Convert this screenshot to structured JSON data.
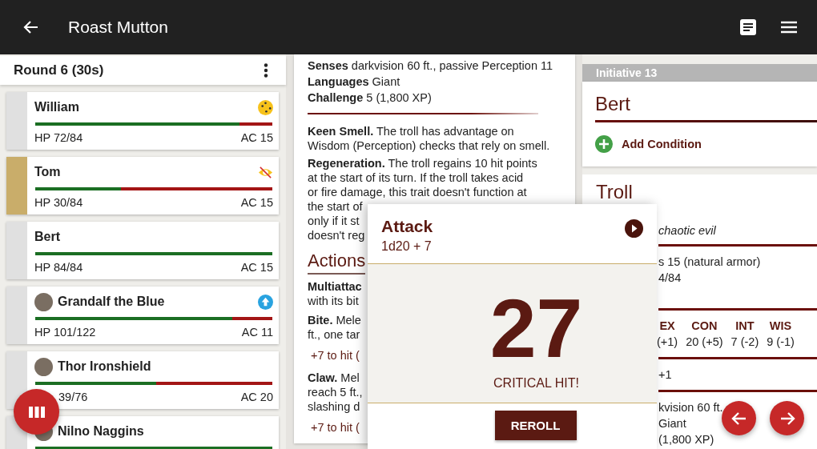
{
  "app_bar": {
    "title": "Roast Mutton"
  },
  "round": {
    "label": "Round 6 (30s)"
  },
  "combatants": [
    {
      "name": "William",
      "kind": "dazed",
      "avatar": false,
      "active": false,
      "level": 0.86,
      "hp": "HP 72/84",
      "ac": "AC 15"
    },
    {
      "name": "Tom",
      "kind": "unseen",
      "avatar": false,
      "active": true,
      "level": 0.36,
      "hp": "HP 30/84",
      "ac": "AC 15"
    },
    {
      "name": "Bert",
      "kind": "plain",
      "avatar": false,
      "active": false,
      "level": 1,
      "hp": "HP 84/84",
      "ac": "AC 15"
    },
    {
      "name": "Grandalf the Blue",
      "kind": "boosted",
      "avatar": true,
      "active": false,
      "level": 0.83,
      "hp": "HP 101/122",
      "ac": "AC 11"
    },
    {
      "name": "Thor Ironshield",
      "kind": "plain",
      "avatar": true,
      "active": false,
      "level": 0.51,
      "hp": "39/76",
      "ac": "AC 20",
      "hp_partly_hidden": true
    },
    {
      "name": "Nilno Naggins",
      "kind": "plain",
      "avatar": true,
      "active": false,
      "level": 1
    }
  ],
  "stat_block": {
    "properties": [
      "**Senses** darkvision 60 ft., passive Perception 11",
      "**Languages** Giant",
      "**Challenge** 5 (1,800 XP)"
    ],
    "traits": [
      [
        "**Keen Smell.** The troll has advantage on",
        "Wisdom (Perception) checks that rely on smell."
      ],
      [
        "**Regeneration.** The troll regains 10 hit points",
        "at the start of its turn. If the troll takes acid",
        "or fire damage, this trait doesn't function at",
        "the start of",
        "only if it st",
        "doesn't reg"
      ]
    ],
    "actions_heading": "Actions",
    "actions": [
      {
        "kind": "text",
        "text": "**Multiattac**\nwith its bit"
      },
      {
        "kind": "text",
        "text": "**Bite.** Mele\nft., one tar"
      },
      {
        "kind": "roll",
        "text": "+7 to hit ("
      },
      {
        "kind": "text",
        "text": "**Claw.** Mel\nreach 5 ft.,\nslashing d"
      },
      {
        "kind": "roll",
        "text": "+7 to hit ("
      }
    ]
  },
  "initiative": {
    "label": "Initiative 13",
    "name": "Bert",
    "add_condition": "Add Condition"
  },
  "monster": {
    "name": "Troll",
    "alignment": "chaotic evil",
    "armor": "s 15 (natural armor)",
    "hp": "4/84",
    "abilities": [
      {
        "name": "EX",
        "score": "(+1)"
      },
      {
        "name": "CON",
        "score": "20 (+5)"
      },
      {
        "name": "INT",
        "score": "7 (-2)"
      },
      {
        "name": "WIS",
        "score": "9 (-1)"
      }
    ],
    "misc": "+1",
    "properties": [
      "kvision 60 ft.",
      "Giant",
      "(1,800 XP)"
    ]
  },
  "roll_dialog": {
    "title": "Attack",
    "formula": "1d20 + 7",
    "result": "27",
    "note": "CRITICAL HIT!",
    "button": "REROLL"
  }
}
